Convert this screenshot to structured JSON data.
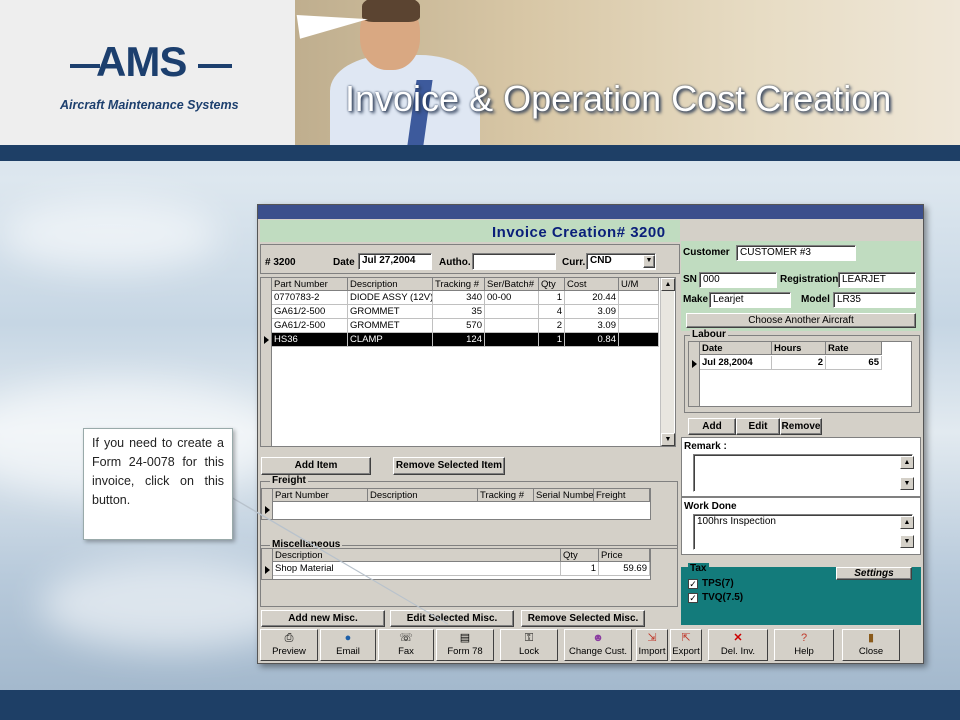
{
  "slide": {
    "logo_text": "AMS",
    "logo_subtitle": "Aircraft Maintenance Systems",
    "title": "Invoice & Operation Cost Creation",
    "callout": "If you need to create a Form 24-0078 for this invoice, click on this button."
  },
  "app": {
    "invoice_title": "Invoice Creation#  3200",
    "header": {
      "number_label": "# 3200",
      "date_label": "Date",
      "date_value": "Jul 27,2004",
      "autho_label": "Autho.",
      "autho_value": "",
      "curr_label": "Curr.",
      "curr_value": "CND"
    },
    "items": {
      "columns": [
        "Part Number",
        "Description",
        "Tracking #",
        "Ser/Batch#",
        "Qty",
        "Cost",
        "U/M"
      ],
      "rows": [
        [
          "0770783-2",
          "DIODE ASSY (12V)",
          "340",
          "00-00",
          "1",
          "20.44",
          ""
        ],
        [
          "GA61/2-500",
          "GROMMET",
          "35",
          "",
          "4",
          "3.09",
          ""
        ],
        [
          "GA61/2-500",
          "GROMMET",
          "570",
          "",
          "2",
          "3.09",
          ""
        ],
        [
          "HS36",
          "CLAMP",
          "124",
          "",
          "1",
          "0.84",
          ""
        ]
      ],
      "add_button": "Add Item",
      "remove_button": "Remove Selected Item"
    },
    "freight": {
      "title": "Freight",
      "columns": [
        "Part Number",
        "Description",
        "Tracking #",
        "Serial Number",
        "Freight"
      ]
    },
    "misc": {
      "title": "Miscellaneous",
      "columns": [
        "Description",
        "Qty",
        "Price"
      ],
      "rows": [
        [
          "Shop Material",
          "1",
          "59.69"
        ]
      ],
      "add_button": "Add new Misc.",
      "edit_button": "Edit Selected Misc.",
      "remove_button": "Remove Selected Misc."
    },
    "customer": {
      "customer_label": "Customer",
      "customer_value": "CUSTOMER #3",
      "sn_label": "SN",
      "sn_value": "000",
      "registration_label": "Registration",
      "registration_value": "LEARJET",
      "make_label": "Make",
      "make_value": "Learjet",
      "model_label": "Model",
      "model_value": "LR35",
      "choose_button": "Choose Another Aircraft"
    },
    "labour": {
      "title": "Labour",
      "columns": [
        "Date",
        "Hours",
        "Rate"
      ],
      "rows": [
        [
          "Jul 28,2004",
          "2",
          "65"
        ]
      ],
      "add_button": "Add",
      "edit_button": "Edit",
      "remove_button": "Remove"
    },
    "remark": {
      "label": "Remark :",
      "value": ""
    },
    "work_done": {
      "label": "Work Done",
      "value": "100hrs Inspection"
    },
    "tax": {
      "title": "Tax",
      "settings_button": "Settings",
      "items": [
        {
          "label": "TPS(7)",
          "checked": true
        },
        {
          "label": "TVQ(7.5)",
          "checked": true
        }
      ]
    },
    "toolbar": [
      {
        "label": "Preview",
        "icon": "printer-icon"
      },
      {
        "label": "Email",
        "icon": "globe-icon"
      },
      {
        "label": "Fax",
        "icon": "fax-icon"
      },
      {
        "label": "Form 78",
        "icon": "book-icon"
      },
      {
        "label": "Lock",
        "icon": "lock-icon"
      },
      {
        "label": "Change Cust.",
        "icon": "people-icon"
      },
      {
        "label": "Import",
        "icon": "import-icon"
      },
      {
        "label": "Export",
        "icon": "export-icon"
      },
      {
        "label": "Del. Inv.",
        "icon": "delete-icon"
      },
      {
        "label": "Help",
        "icon": "help-icon"
      },
      {
        "label": "Close",
        "icon": "door-icon"
      }
    ]
  }
}
